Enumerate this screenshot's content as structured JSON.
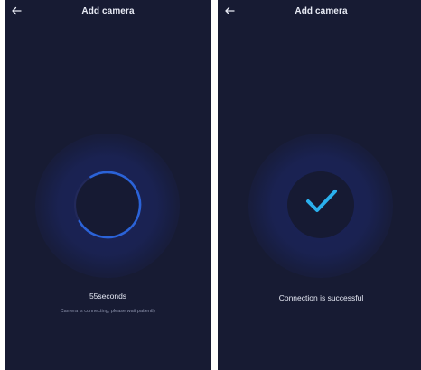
{
  "colors": {
    "background": "#171b33",
    "accent": "#2b63d8",
    "check": "#2ab0ee",
    "text_primary": "#e6e9f4",
    "text_secondary": "#8d93ad"
  },
  "screens": [
    {
      "header": {
        "back_icon": "arrow-left-icon",
        "title": "Add camera"
      },
      "status": {
        "countdown": "55seconds",
        "message": "Camera is connecting, please wait patiently"
      }
    },
    {
      "header": {
        "back_icon": "arrow-left-icon",
        "title": "Add camera"
      },
      "status": {
        "icon": "checkmark-icon",
        "message": "Connection is successful"
      }
    }
  ]
}
